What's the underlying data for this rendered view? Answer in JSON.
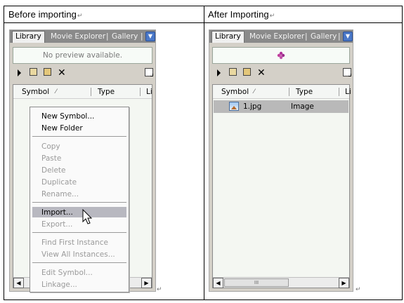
{
  "table": {
    "left_header": "Before importing",
    "right_header": "After Importing",
    "paragraph_mark": "↵"
  },
  "before_panel": {
    "tabs": [
      "Library",
      "Movie Explorer",
      "Gallery"
    ],
    "tab_separator": "|",
    "preview_text": "No preview available.",
    "columns": [
      "Symbol",
      "Type",
      "Li"
    ],
    "scroll_left": "◀",
    "scroll_right": "▶"
  },
  "context_menu": {
    "groups": [
      [
        {
          "label": "New Symbol...",
          "enabled": true
        },
        {
          "label": "New Folder",
          "enabled": true
        }
      ],
      [
        {
          "label": "Copy",
          "enabled": false
        },
        {
          "label": "Paste",
          "enabled": false
        },
        {
          "label": "Delete",
          "enabled": false
        },
        {
          "label": "Duplicate",
          "enabled": false
        },
        {
          "label": "Rename...",
          "enabled": false
        }
      ],
      [
        {
          "label": "Import...",
          "enabled": true,
          "highlighted": true
        },
        {
          "label": "Export...",
          "enabled": false
        }
      ],
      [
        {
          "label": "Find First Instance",
          "enabled": false
        },
        {
          "label": "View All Instances...",
          "enabled": false
        }
      ],
      [
        {
          "label": "Edit Symbol...",
          "enabled": false
        },
        {
          "label": "Linkage...",
          "enabled": false
        }
      ]
    ],
    "highlight_color": "#b8b8c0"
  },
  "after_panel": {
    "tabs": [
      "Library",
      "Movie Explorer",
      "Gallery"
    ],
    "tab_separator": "|",
    "columns": [
      "Symbol",
      "Type",
      "Li"
    ],
    "items": [
      {
        "name": "1.jpg",
        "type": "Image",
        "selected": true
      }
    ],
    "scroll_left": "◀",
    "scroll_right": "▶",
    "thumb_grip": "III"
  },
  "colors": {
    "tab_bar": "#8a8a8a",
    "menu_button": "#4a78c8",
    "list_bg": "#f4f7f2",
    "selection": "#b9b9b9"
  }
}
